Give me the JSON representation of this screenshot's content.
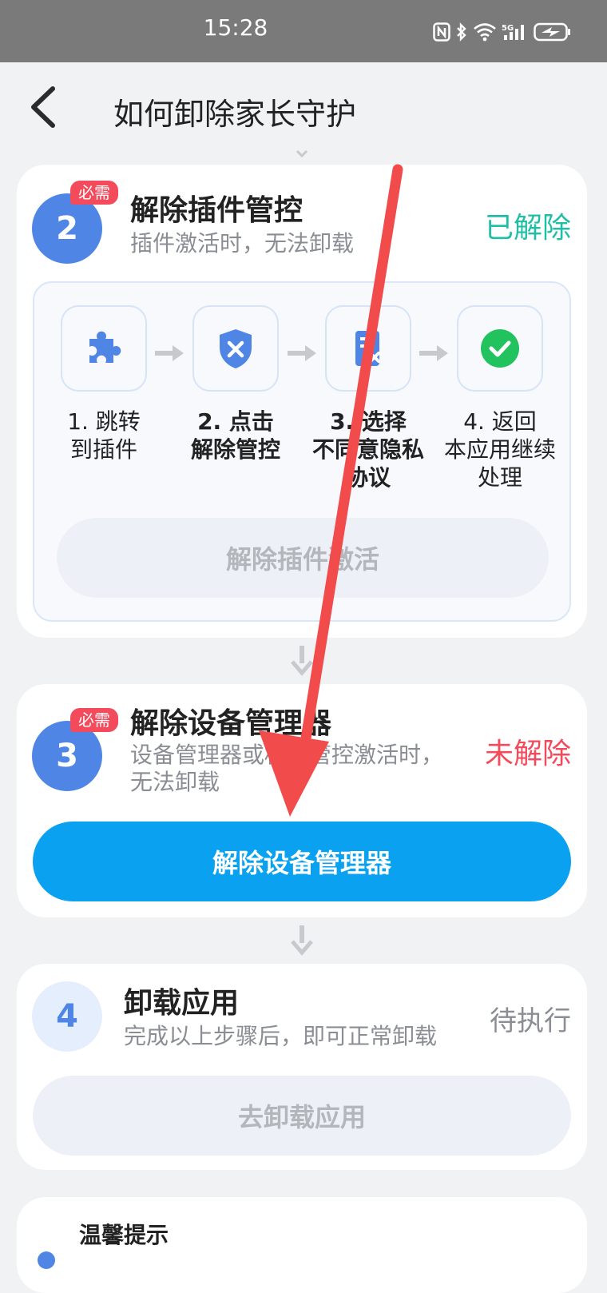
{
  "status_bar": {
    "time": "15:28",
    "icons": [
      "nfc-icon",
      "bluetooth-icon",
      "wifi-icon",
      "5g-signal-icon",
      "battery-charging-icon"
    ]
  },
  "nav": {
    "title": "如何卸除家长守护",
    "back_icon": "chevron-left-icon"
  },
  "step2": {
    "number": "2",
    "badge": "必需",
    "title": "解除插件管控",
    "subtitle": "插件激活时，无法卸载",
    "status": "已解除",
    "flow": [
      {
        "icon": "puzzle-icon",
        "label": "1. 跳转到插件"
      },
      {
        "icon": "shield-x-icon",
        "label": "2. 点击解除管控"
      },
      {
        "icon": "document-x-icon",
        "label": "3. 选择不同意隐私协议"
      },
      {
        "icon": "check-circle-icon",
        "label": "4. 返回本应用继续处理"
      }
    ],
    "button": "解除插件激活"
  },
  "step3": {
    "number": "3",
    "badge": "必需",
    "title": "解除设备管理器",
    "subtitle_line1": "设备管理器或权限管控激活时，",
    "subtitle_line2": "无法卸载",
    "status": "未解除",
    "button": "解除设备管理器"
  },
  "step4": {
    "number": "4",
    "title": "卸载应用",
    "subtitle": "完成以上步骤后，即可正常卸载",
    "status": "待执行",
    "button": "去卸载应用"
  },
  "tips": {
    "title": "温馨提示"
  },
  "colors": {
    "accent_blue": "#4f86e6",
    "primary_button": "#0aa2f0",
    "done_green": "#1fbfa6",
    "required_red": "#f34a5c",
    "annotation_arrow": "#f24b4b"
  }
}
